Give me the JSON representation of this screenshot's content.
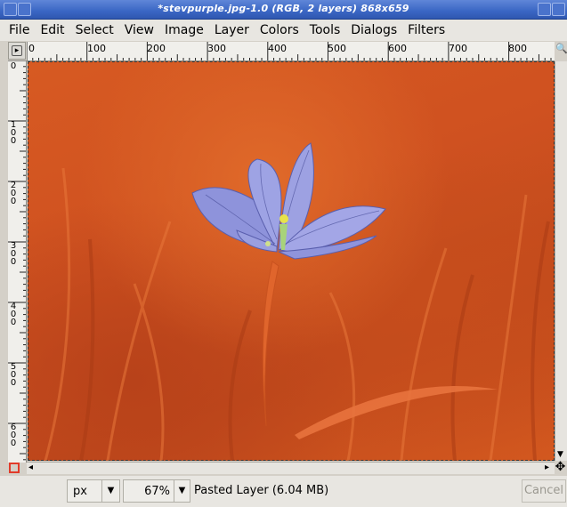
{
  "window": {
    "title": "*stevpurple.jpg-1.0 (RGB, 2 layers) 868x659"
  },
  "menubar": {
    "items": [
      "File",
      "Edit",
      "Select",
      "View",
      "Image",
      "Layer",
      "Colors",
      "Tools",
      "Dialogs",
      "Filters"
    ]
  },
  "ruler": {
    "h_labels": [
      "0",
      "100",
      "200",
      "300",
      "400",
      "500",
      "600",
      "700",
      "800"
    ],
    "v_labels": [
      "0",
      "100",
      "200",
      "300",
      "400",
      "500",
      "600"
    ]
  },
  "statusbar": {
    "unit": "px",
    "zoom": "67%",
    "status": "Pasted Layer (6.04 MB)",
    "cancel_label": "Cancel"
  },
  "icons": {
    "menu_arrow": "menu-arrow-icon",
    "nav_zoom": "magnifier-icon",
    "quick_mask": "quick-mask-icon",
    "navigate": "navigate-move-icon",
    "dropdown": "chevron-down-icon"
  }
}
